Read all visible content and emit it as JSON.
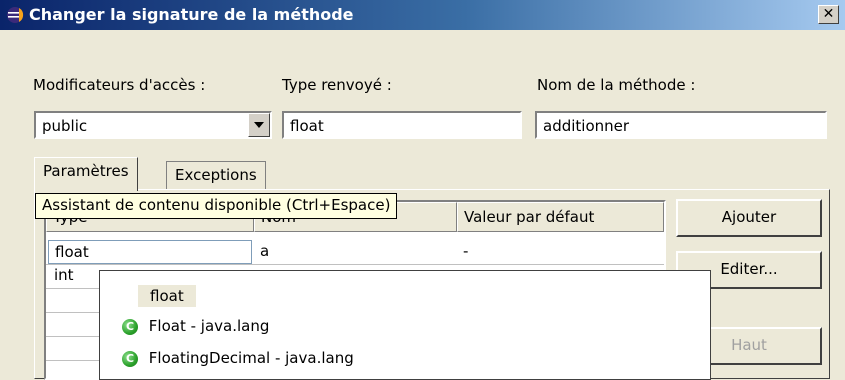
{
  "window": {
    "title": "Changer la signature de la méthode",
    "close_symbol": "✕"
  },
  "labels": {
    "modifiers": "Modificateurs d'accès :",
    "return_type": "Type renvoyé :",
    "method_name": "Nom de la méthode :"
  },
  "fields": {
    "modifier_value": "public",
    "return_type_value": "float",
    "method_name_value": "additionner"
  },
  "tabs": [
    {
      "label": "Paramètres",
      "active": true
    },
    {
      "label": "Exceptions",
      "active": false
    }
  ],
  "table": {
    "columns": [
      "Type",
      "Nom",
      "Valeur par défaut"
    ],
    "rows": [
      {
        "type": "float",
        "name": "a",
        "default": "-"
      },
      {
        "type": "int",
        "name": "",
        "default": ""
      }
    ]
  },
  "buttons": {
    "add": "Ajouter",
    "edit": "Editer...",
    "up": "Haut"
  },
  "tooltip": "Assistant de contenu disponible (Ctrl+Espace)",
  "autocomplete": {
    "items": [
      {
        "label": "float",
        "kind": "keyword",
        "selected": true
      },
      {
        "label": "Float - java.lang",
        "kind": "class-icon"
      },
      {
        "label": "FloatingDecimal - java.lang",
        "kind": "class-icon"
      }
    ]
  }
}
